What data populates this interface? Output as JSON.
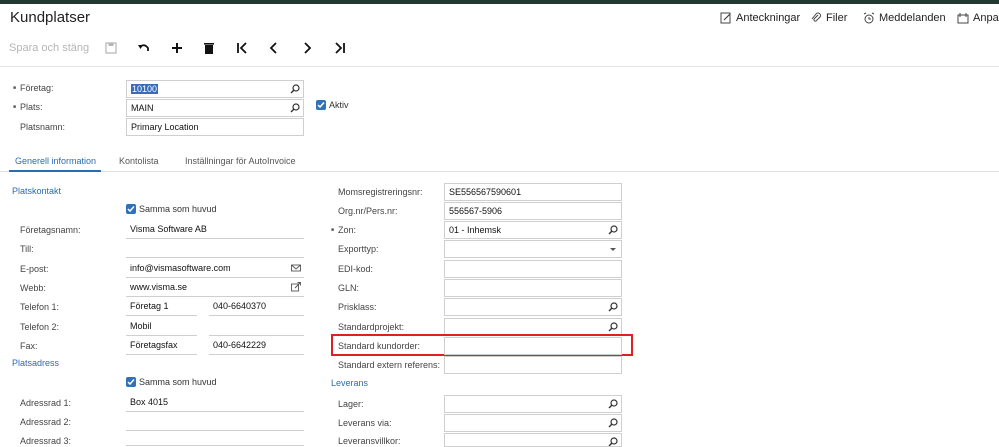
{
  "header": {
    "title": "Kundplatser",
    "links": {
      "notes": "Anteckningar",
      "files": "Filer",
      "messages": "Meddelanden",
      "customize": "Anpas"
    }
  },
  "toolbar": {
    "save_close": "Spara och stäng"
  },
  "top_fields": {
    "foretag_label": "Företag:",
    "foretag_value": "10100",
    "plats_label": "Plats:",
    "plats_value": "MAIN",
    "aktiv_label": "Aktiv",
    "platsnamn_label": "Platsnamn:",
    "platsnamn_value": "Primary Location"
  },
  "tabs": {
    "general": "Generell information",
    "accounts": "Kontolista",
    "autoinvoice": "Inställningar för AutoInvoice"
  },
  "contact": {
    "section_title": "Platskontakt",
    "same_as_main": "Samma som huvud",
    "company_name_label": "Företagsnamn:",
    "company_name_value": "Visma Software AB",
    "attention_label": "Till:",
    "email_label": "E-post:",
    "email_value": "info@vismasoftware.com",
    "web_label": "Webb:",
    "web_value": "www.visma.se",
    "phone1_label": "Telefon 1:",
    "phone1_type": "Företag 1",
    "phone1_value": "040-6640370",
    "phone2_label": "Telefon 2:",
    "phone2_type": "Mobil",
    "fax_label": "Fax:",
    "fax_type": "Företagsfax",
    "fax_value": "040-6642229"
  },
  "address": {
    "section_title": "Platsadress",
    "same_as_main": "Samma som huvud",
    "line1_label": "Adressrad 1:",
    "line1_value": "Box 4015",
    "line2_label": "Adressrad 2:",
    "line3_label": "Adressrad 3:"
  },
  "right": {
    "vat_label": "Momsregistreringsnr:",
    "vat_value": "SE556567590601",
    "orgnr_label": "Org.nr/Pers.nr:",
    "orgnr_value": "556567-5906",
    "zone_label": "Zon:",
    "zone_value": "01 - Inhemsk",
    "export_label": "Exporttyp:",
    "edi_label": "EDI-kod:",
    "gln_label": "GLN:",
    "priceclass_label": "Prisklass:",
    "stdproject_label": "Standardprojekt:",
    "stdorder_label": "Standard kundorder:",
    "stdextref_label": "Standard extern referens:",
    "delivery_title": "Leverans",
    "warehouse_label": "Lager:",
    "shipvia_label": "Leverans via:",
    "shipterms_label": "Leveransvillkor:"
  },
  "colors": {
    "accent": "#2b6cb0",
    "highlight": "#e02020",
    "topbar": "#223a32"
  }
}
